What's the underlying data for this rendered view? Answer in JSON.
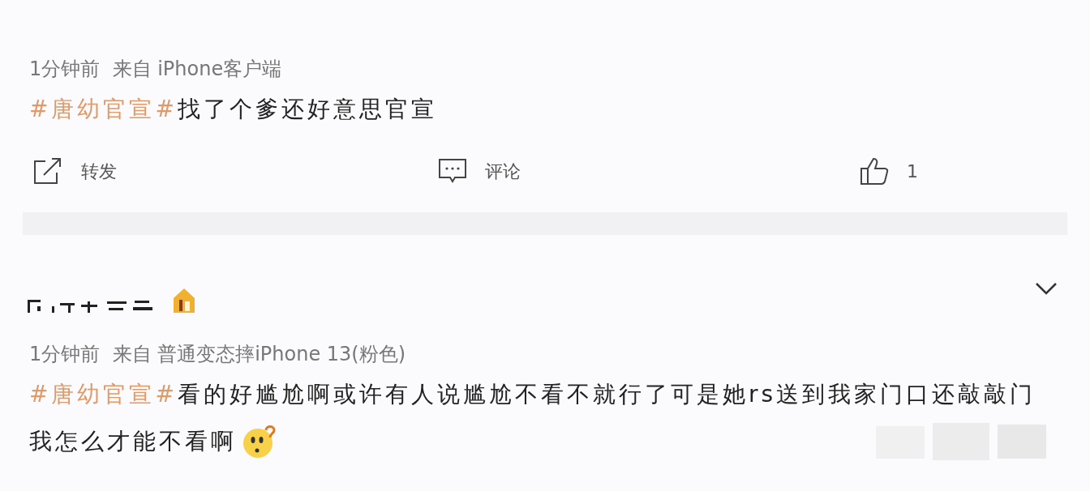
{
  "posts": [
    {
      "meta": "1分钟前  来自 iPhone客户端",
      "topic": "#唐幼官宣#",
      "lines": [
        "找了个爹还好意思官宣"
      ],
      "actions": [
        {
          "kind": "repost",
          "label": "转发"
        },
        {
          "kind": "comment",
          "label": "评论"
        },
        {
          "kind": "like",
          "label": "1"
        }
      ]
    },
    {
      "meta": "1分钟前  来自 普通变态摔iPhone 13(粉色)",
      "topic": "#唐幼官宣#",
      "lines": [
        "看的好尴尬啊或许有人说尴尬不看不就行了可是她rs送到我家门口还敲敲门",
        "我怎么才能不看啊"
      ]
    }
  ]
}
